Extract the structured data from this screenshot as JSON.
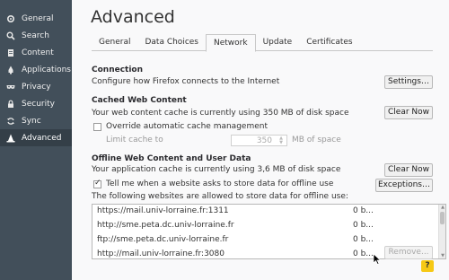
{
  "sidebar": {
    "items": [
      {
        "label": "General",
        "icon": "gear-icon"
      },
      {
        "label": "Search",
        "icon": "search-icon"
      },
      {
        "label": "Content",
        "icon": "document-icon"
      },
      {
        "label": "Applications",
        "icon": "rocket-icon"
      },
      {
        "label": "Privacy",
        "icon": "mask-icon"
      },
      {
        "label": "Security",
        "icon": "lock-icon"
      },
      {
        "label": "Sync",
        "icon": "sync-icon"
      },
      {
        "label": "Advanced",
        "icon": "wizard-hat-icon",
        "active": true
      }
    ]
  },
  "page": {
    "title": "Advanced"
  },
  "tabs": [
    {
      "label": "General"
    },
    {
      "label": "Data Choices"
    },
    {
      "label": "Network",
      "active": true
    },
    {
      "label": "Update"
    },
    {
      "label": "Certificates"
    }
  ],
  "connection": {
    "title": "Connection",
    "description": "Configure how Firefox connects to the Internet",
    "settings_button": "Settings…"
  },
  "cached": {
    "title": "Cached Web Content",
    "description": "Your web content cache is currently using 350 MB of disk space",
    "clear_button": "Clear Now",
    "override_label": "Override automatic cache management",
    "override_checked": false,
    "limit_label": "Limit cache to",
    "limit_value": "350",
    "limit_unit": "MB of space"
  },
  "offline": {
    "title": "Offline Web Content and User Data",
    "description": "Your application cache is currently using 3,6 MB of disk space",
    "clear_button": "Clear Now",
    "tell_me_label": "Tell me when a website asks to store data for offline use",
    "tell_me_checked": true,
    "exceptions_button": "Exceptions…",
    "allowed_label": "The following websites are allowed to store data for offline use:",
    "sites": [
      {
        "url": "https://mail.univ-lorraine.fr:1311",
        "size": "0 b..."
      },
      {
        "url": "http://sme.peta.dc.univ-lorraine.fr",
        "size": "0 b..."
      },
      {
        "url": "ftp://sme.peta.dc.univ-lorraine.fr",
        "size": "0 b..."
      },
      {
        "url": "http://mail.univ-lorraine.fr:3080",
        "size": "0 b..."
      }
    ],
    "remove_button": "Remove..."
  },
  "help_button": "?",
  "colors": {
    "sidebar_bg": "#424f5a",
    "sidebar_active": "#343f48",
    "help_bg": "#f6c915"
  }
}
